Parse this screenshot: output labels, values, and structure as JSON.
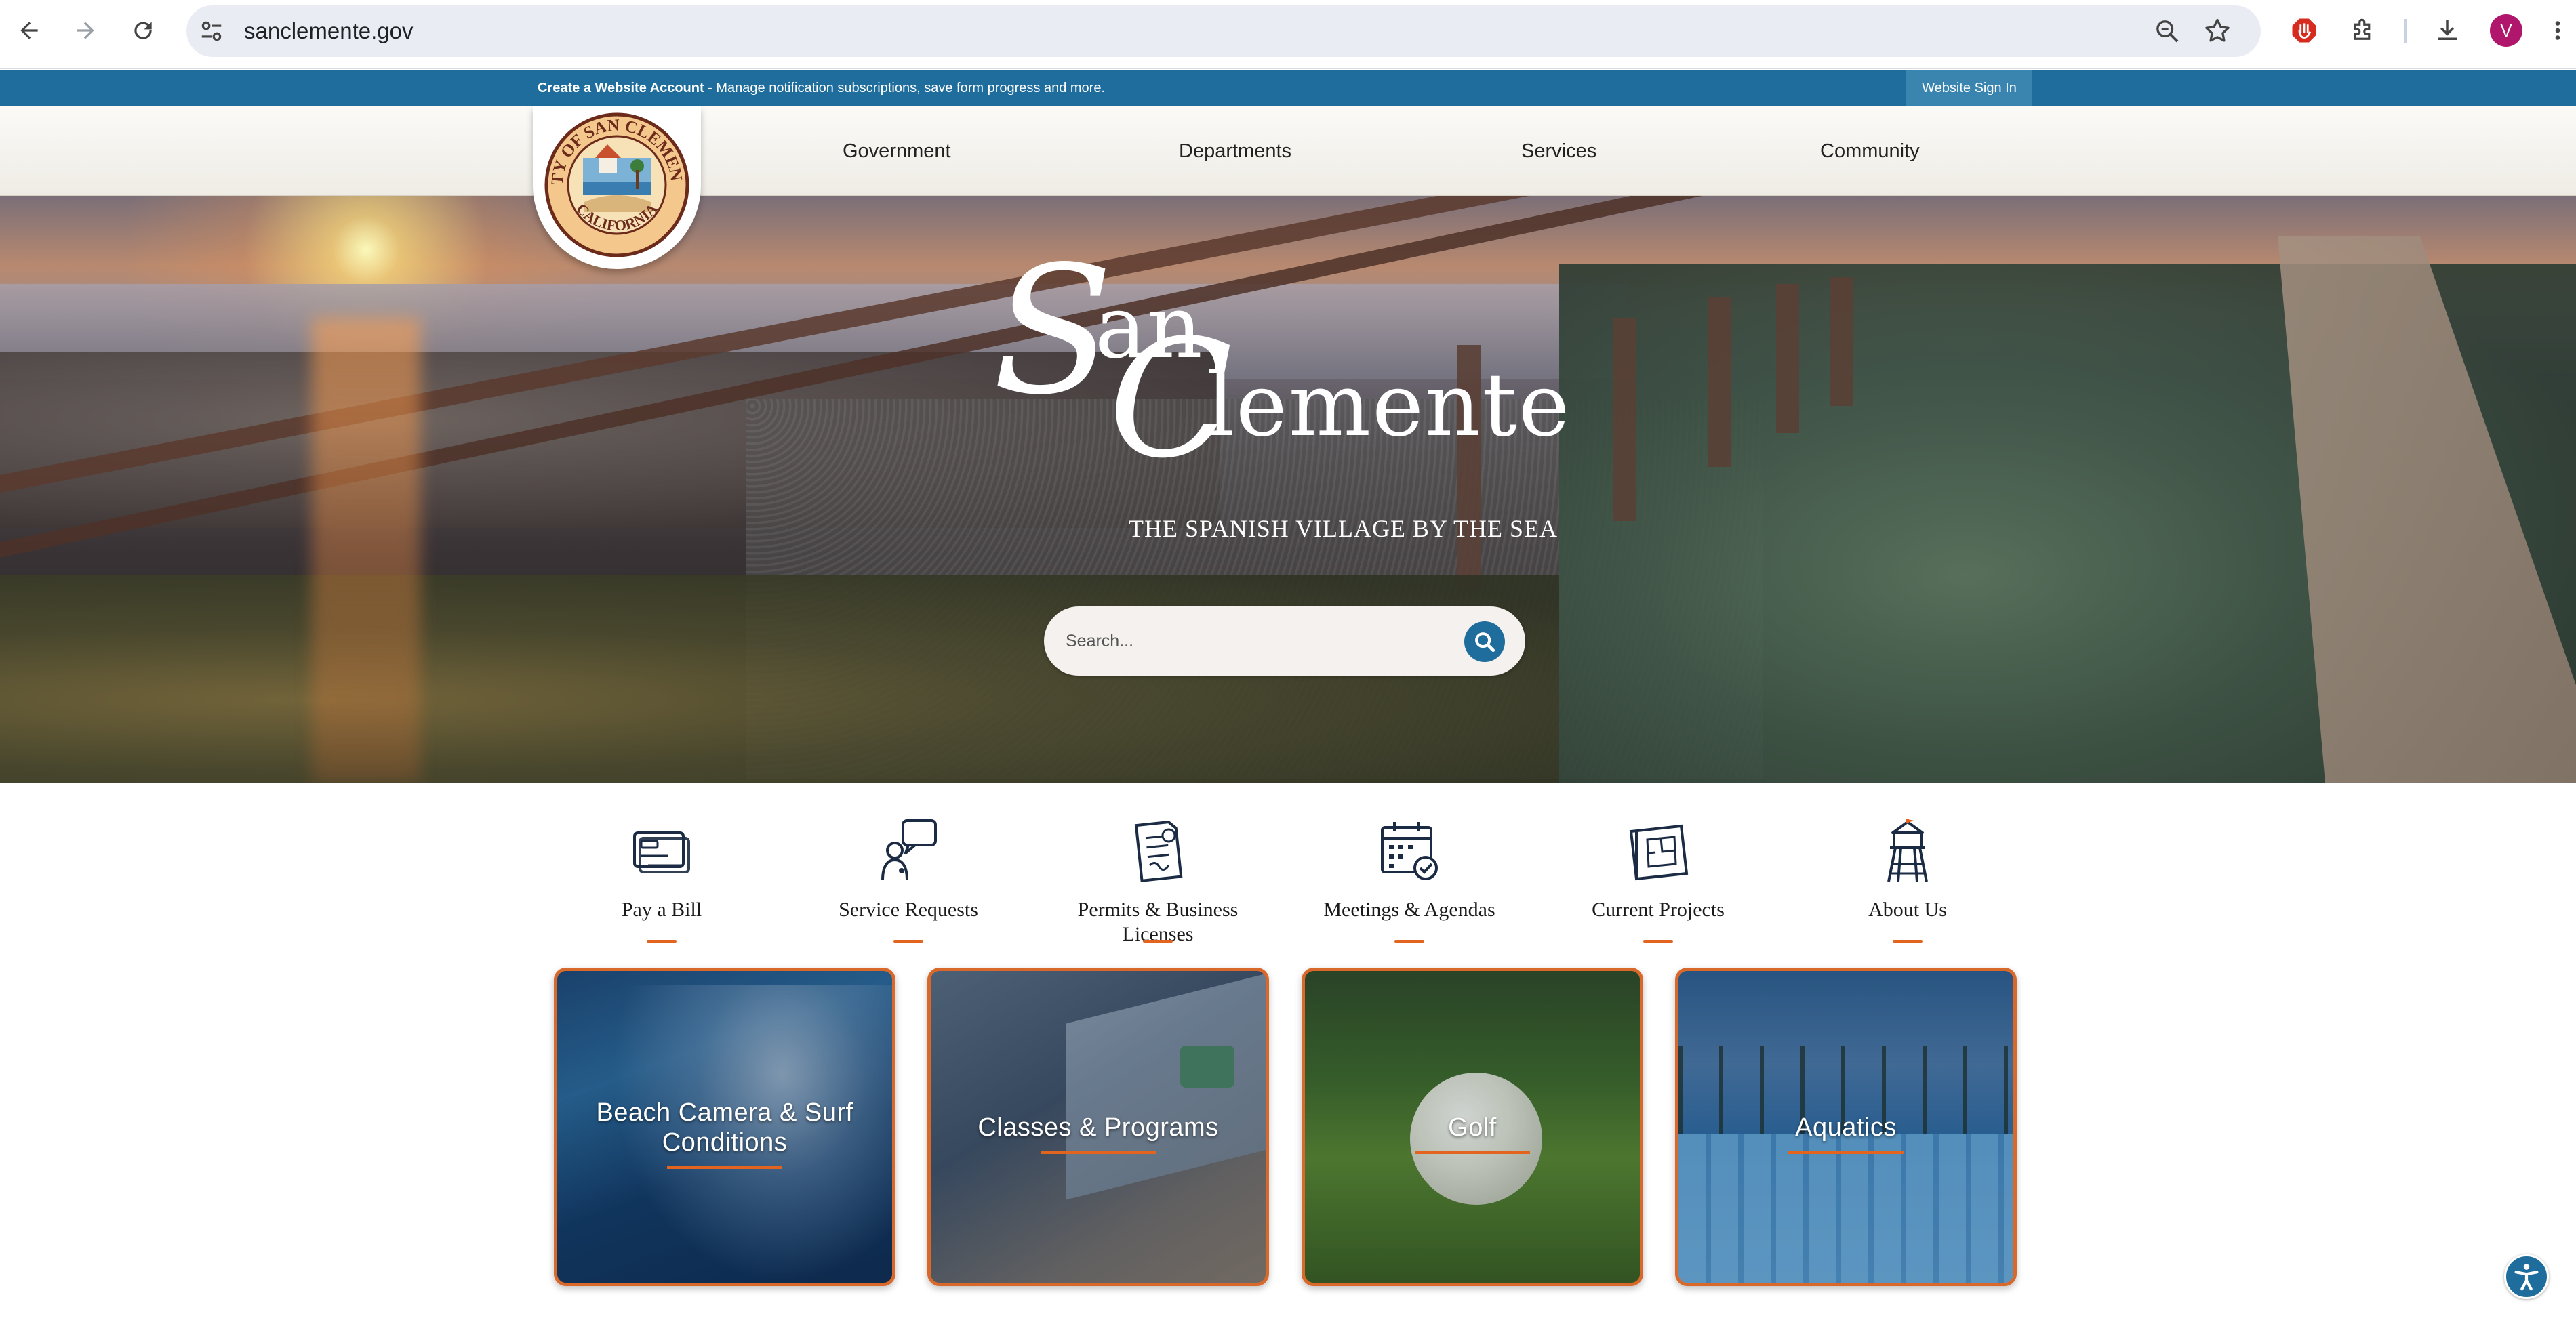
{
  "browser": {
    "url": "sanclemente.gov",
    "profile_initial": "V",
    "icons": [
      "back-arrow-icon",
      "forward-arrow-icon",
      "reload-icon",
      "site-settings-icon",
      "zoom-icon",
      "bookmark-star-icon",
      "adblock-extension-icon",
      "extensions-puzzle-icon",
      "download-icon",
      "menu-kebab-icon"
    ]
  },
  "account_bar": {
    "link": "Create a Website Account",
    "message": " - Manage notification subscriptions, save form progress and more.",
    "signin": "Website Sign In"
  },
  "header": {
    "seal_text_top": "CITY OF SAN CLEMENTE",
    "seal_text_bottom": "CALIFORNIA",
    "nav": [
      "Government",
      "Departments",
      "Services",
      "Community"
    ]
  },
  "hero": {
    "title_line1_initial": "S",
    "title_line1_rest": "an",
    "title_line2_initial": "C",
    "title_line2_rest": "lemente",
    "tagline": "THE SPANISH VILLAGE BY THE SEA",
    "search_placeholder": "Search..."
  },
  "quick_links": [
    {
      "label": "Pay a Bill",
      "icon": "credit-card-icon"
    },
    {
      "label": "Service Requests",
      "icon": "person-speech-bubble-icon"
    },
    {
      "label": "Permits & Business Licenses",
      "icon": "permit-document-icon"
    },
    {
      "label": "Meetings & Agendas",
      "icon": "calendar-check-icon"
    },
    {
      "label": "Current Projects",
      "icon": "blueprint-icon"
    },
    {
      "label": "About Us",
      "icon": "lifeguard-tower-icon"
    }
  ],
  "feature_cards": [
    {
      "title": "Beach Camera & Surf Conditions"
    },
    {
      "title": "Classes & Programs"
    },
    {
      "title": "Golf"
    },
    {
      "title": "Aquatics"
    }
  ],
  "colors": {
    "brand_blue": "#1f6d9c",
    "accent_orange": "#e2641f",
    "icon_navy": "#1c2b44"
  }
}
